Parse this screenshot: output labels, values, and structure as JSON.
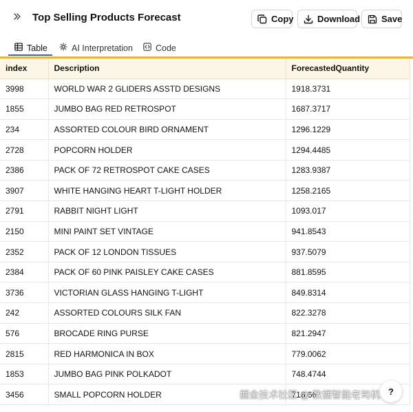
{
  "header": {
    "title": "Top Selling Products Forecast",
    "buttons": {
      "copy": "Copy",
      "download": "Download",
      "save": "Save"
    }
  },
  "tabs": [
    {
      "label": "Table",
      "icon": "table-icon",
      "active": true
    },
    {
      "label": "AI Interpretation",
      "icon": "sparkle-gear-icon",
      "active": false
    },
    {
      "label": "Code",
      "icon": "code-icon",
      "active": false
    }
  ],
  "table": {
    "columns": [
      "index",
      "Description",
      "ForecastedQuantity"
    ],
    "rows": [
      [
        "3998",
        "WORLD WAR 2 GLIDERS ASSTD DESIGNS",
        "1918.3731"
      ],
      [
        "1855",
        "JUMBO BAG RED RETROSPOT",
        "1687.3717"
      ],
      [
        "234",
        "ASSORTED COLOUR BIRD ORNAMENT",
        "1296.1229"
      ],
      [
        "2728",
        "POPCORN HOLDER",
        "1294.4485"
      ],
      [
        "2386",
        "PACK OF 72 RETROSPOT CAKE CASES",
        "1283.9387"
      ],
      [
        "3907",
        "WHITE HANGING HEART T-LIGHT HOLDER",
        "1258.2165"
      ],
      [
        "2791",
        "RABBIT NIGHT LIGHT",
        "1093.017"
      ],
      [
        "2150",
        "MINI PAINT SET VINTAGE",
        "941.8543"
      ],
      [
        "2352",
        "PACK OF 12 LONDON TISSUES",
        "937.5079"
      ],
      [
        "2384",
        "PACK OF 60 PINK PAISLEY CAKE CASES",
        "881.8595"
      ],
      [
        "3736",
        "VICTORIAN GLASS HANGING T-LIGHT",
        "849.8314"
      ],
      [
        "242",
        "ASSORTED COLOURS SILK FAN",
        "822.3278"
      ],
      [
        "576",
        "BROCADE RING PURSE",
        "821.2947"
      ],
      [
        "2815",
        "RED  HARMONICA IN BOX",
        "779.0062"
      ],
      [
        "1853",
        "JUMBO BAG PINK POLKADOT",
        "748.4744"
      ],
      [
        "3456",
        "SMALL POPCORN HOLDER",
        "716.66"
      ]
    ]
  },
  "watermark": "掘金技术社区 @ 数据智能老司机",
  "help_button": "?",
  "colors": {
    "accent": "#2563eb",
    "header_rule": "#ecb33a",
    "header_bg": "#fdf7e7"
  }
}
